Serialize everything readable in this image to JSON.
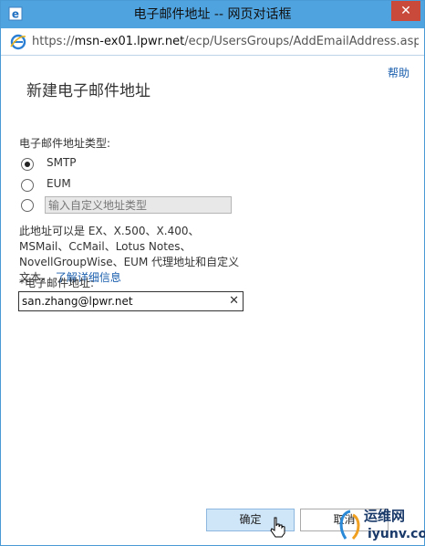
{
  "window": {
    "title": "电子邮件地址 -- 网页对话框",
    "close_glyph": "✕"
  },
  "addressbar": {
    "scheme": "https://",
    "host": "msn-ex01.lpwr.net",
    "path": "/ecp/UsersGroups/AddEmailAddress.aspx?r"
  },
  "dialog": {
    "help": "帮助",
    "title": "新建电子邮件地址",
    "type_label": "电子邮件地址类型:",
    "options": [
      {
        "label": "SMTP",
        "selected": true
      },
      {
        "label": "EUM",
        "selected": false
      },
      {
        "label": "",
        "selected": false
      }
    ],
    "custom_type_placeholder": "输入自定义地址类型",
    "description": "此地址可以是 EX、X.500、X.400、MSMail、CcMail、Lotus Notes、NovellGroupWise、EUM 代理地址和自定义文本。",
    "learn_more": "了解详细信息",
    "email_label": "*电子邮件地址:",
    "email_value": "san.zhang@lpwr.net",
    "clear_glyph": "✕",
    "ok": "确定",
    "cancel": "取消"
  },
  "watermark": {
    "text1": "运维网",
    "text2": "iyunv.com"
  },
  "colors": {
    "titlebar": "#4fa3df",
    "link": "#1b5fae",
    "close": "#c94a3b",
    "ok_bg": "#cfe5f8"
  }
}
